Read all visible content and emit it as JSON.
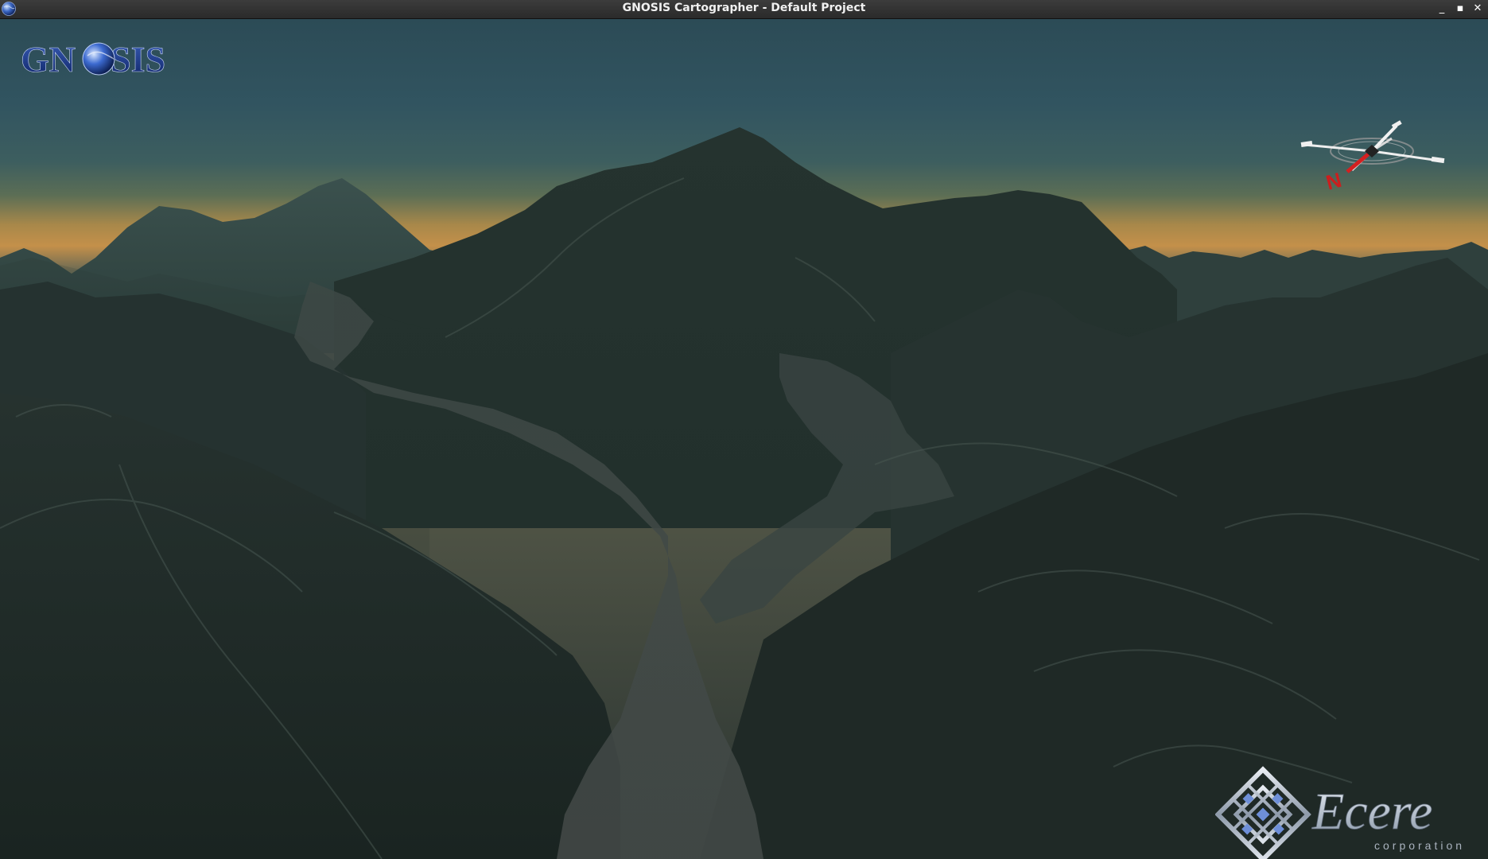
{
  "window": {
    "title": "GNOSIS Cartographer - Default Project",
    "minimize_label": "_",
    "maximize_label": "▪",
    "close_label": "✕"
  },
  "logos": {
    "gnosis": "GNOSIS",
    "ecere": "Ecere",
    "ecere_sub": "corporation"
  },
  "compass": {
    "north_label": "N"
  },
  "colors": {
    "sky_top": "#2c4b56",
    "sky_horizon": "#c4904a",
    "terrain": "#26332f",
    "valley": "#3a4441",
    "titlebar": "#333333"
  }
}
